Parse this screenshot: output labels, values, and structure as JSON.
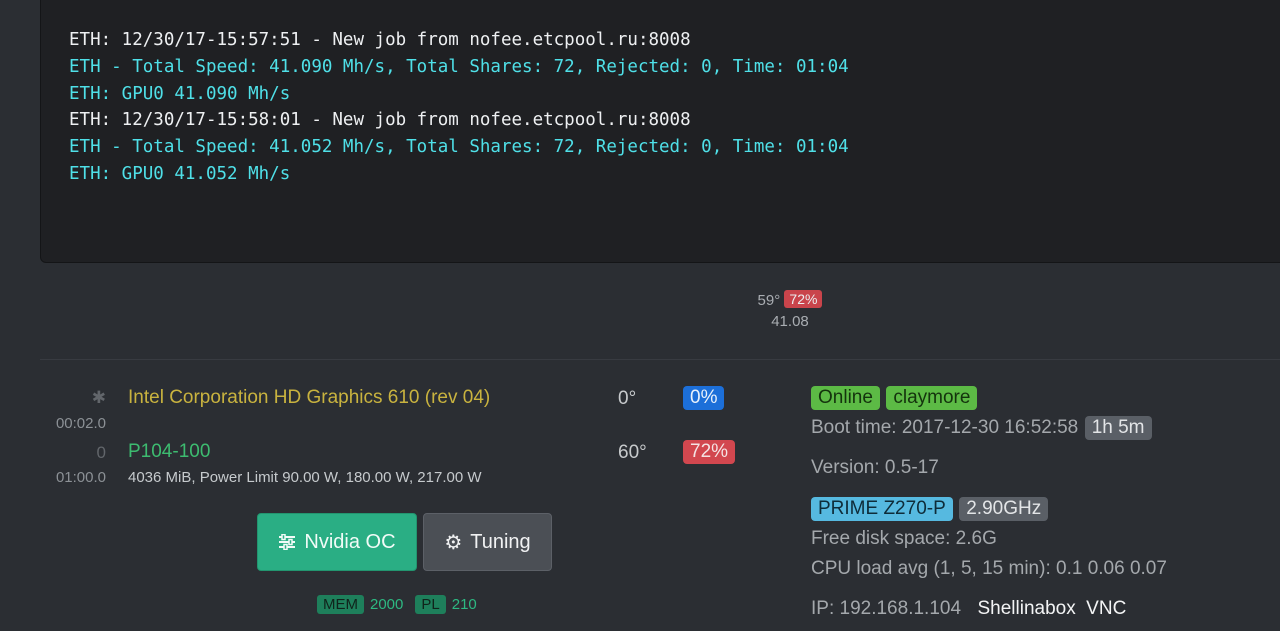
{
  "console": {
    "lines": [
      {
        "text": "ETH: 12/30/17-15:57:51 - New job from nofee.etcpool.ru:8008",
        "color": "white"
      },
      {
        "text": "ETH - Total Speed: 41.090 Mh/s, Total Shares: 72, Rejected: 0, Time: 01:04",
        "color": "cyan"
      },
      {
        "text": "ETH: GPU0 41.090 Mh/s",
        "color": "cyan"
      },
      {
        "text": "ETH: 12/30/17-15:58:01 - New job from nofee.etcpool.ru:8008",
        "color": "white"
      },
      {
        "text": "ETH - Total Speed: 41.052 Mh/s, Total Shares: 72, Rejected: 0, Time: 01:04",
        "color": "cyan"
      },
      {
        "text": "ETH: GPU0 41.052 Mh/s",
        "color": "cyan"
      }
    ]
  },
  "summary": {
    "temp": "59°",
    "fan": "72%",
    "hashrate": "41.08"
  },
  "gpus": [
    {
      "index_icon": "asterisk-icon",
      "bus": "00:02.0",
      "name": "Intel Corporation HD Graphics 610 (rev 04)",
      "temp": "0°",
      "fan": "0%"
    },
    {
      "index": "0",
      "bus": "01:00.0",
      "name": "P104-100",
      "info": "4036 MiB, Power Limit 90.00 W, 180.00 W, 217.00 W",
      "temp": "60°",
      "fan": "72%"
    }
  ],
  "buttons": {
    "nvidia_oc": "Nvidia OC",
    "tuning": "Tuning"
  },
  "oc": {
    "mem_label": "MEM",
    "mem_value": "2000",
    "pl_label": "PL",
    "pl_value": "210"
  },
  "status": {
    "online": "Online",
    "miner": "claymore",
    "boot_time": "Boot time: 2017-12-30 16:52:58",
    "uptime": "1h 5m",
    "version": "Version: 0.5-17",
    "motherboard": "PRIME Z270-P",
    "cpu_freq": "2.90GHz",
    "disk": "Free disk space: 2.6G",
    "cpu_load": "CPU load avg (1, 5, 15 min): 0.1 0.06 0.07",
    "ip": "IP: 192.168.1.104",
    "shellinabox": "Shellinabox",
    "vnc": "VNC"
  },
  "colors": {
    "accent_green": "#2aae84",
    "console_cyan": "#4fe0e8",
    "label_red": "#d2474f",
    "label_blue": "#1c6fd9"
  }
}
